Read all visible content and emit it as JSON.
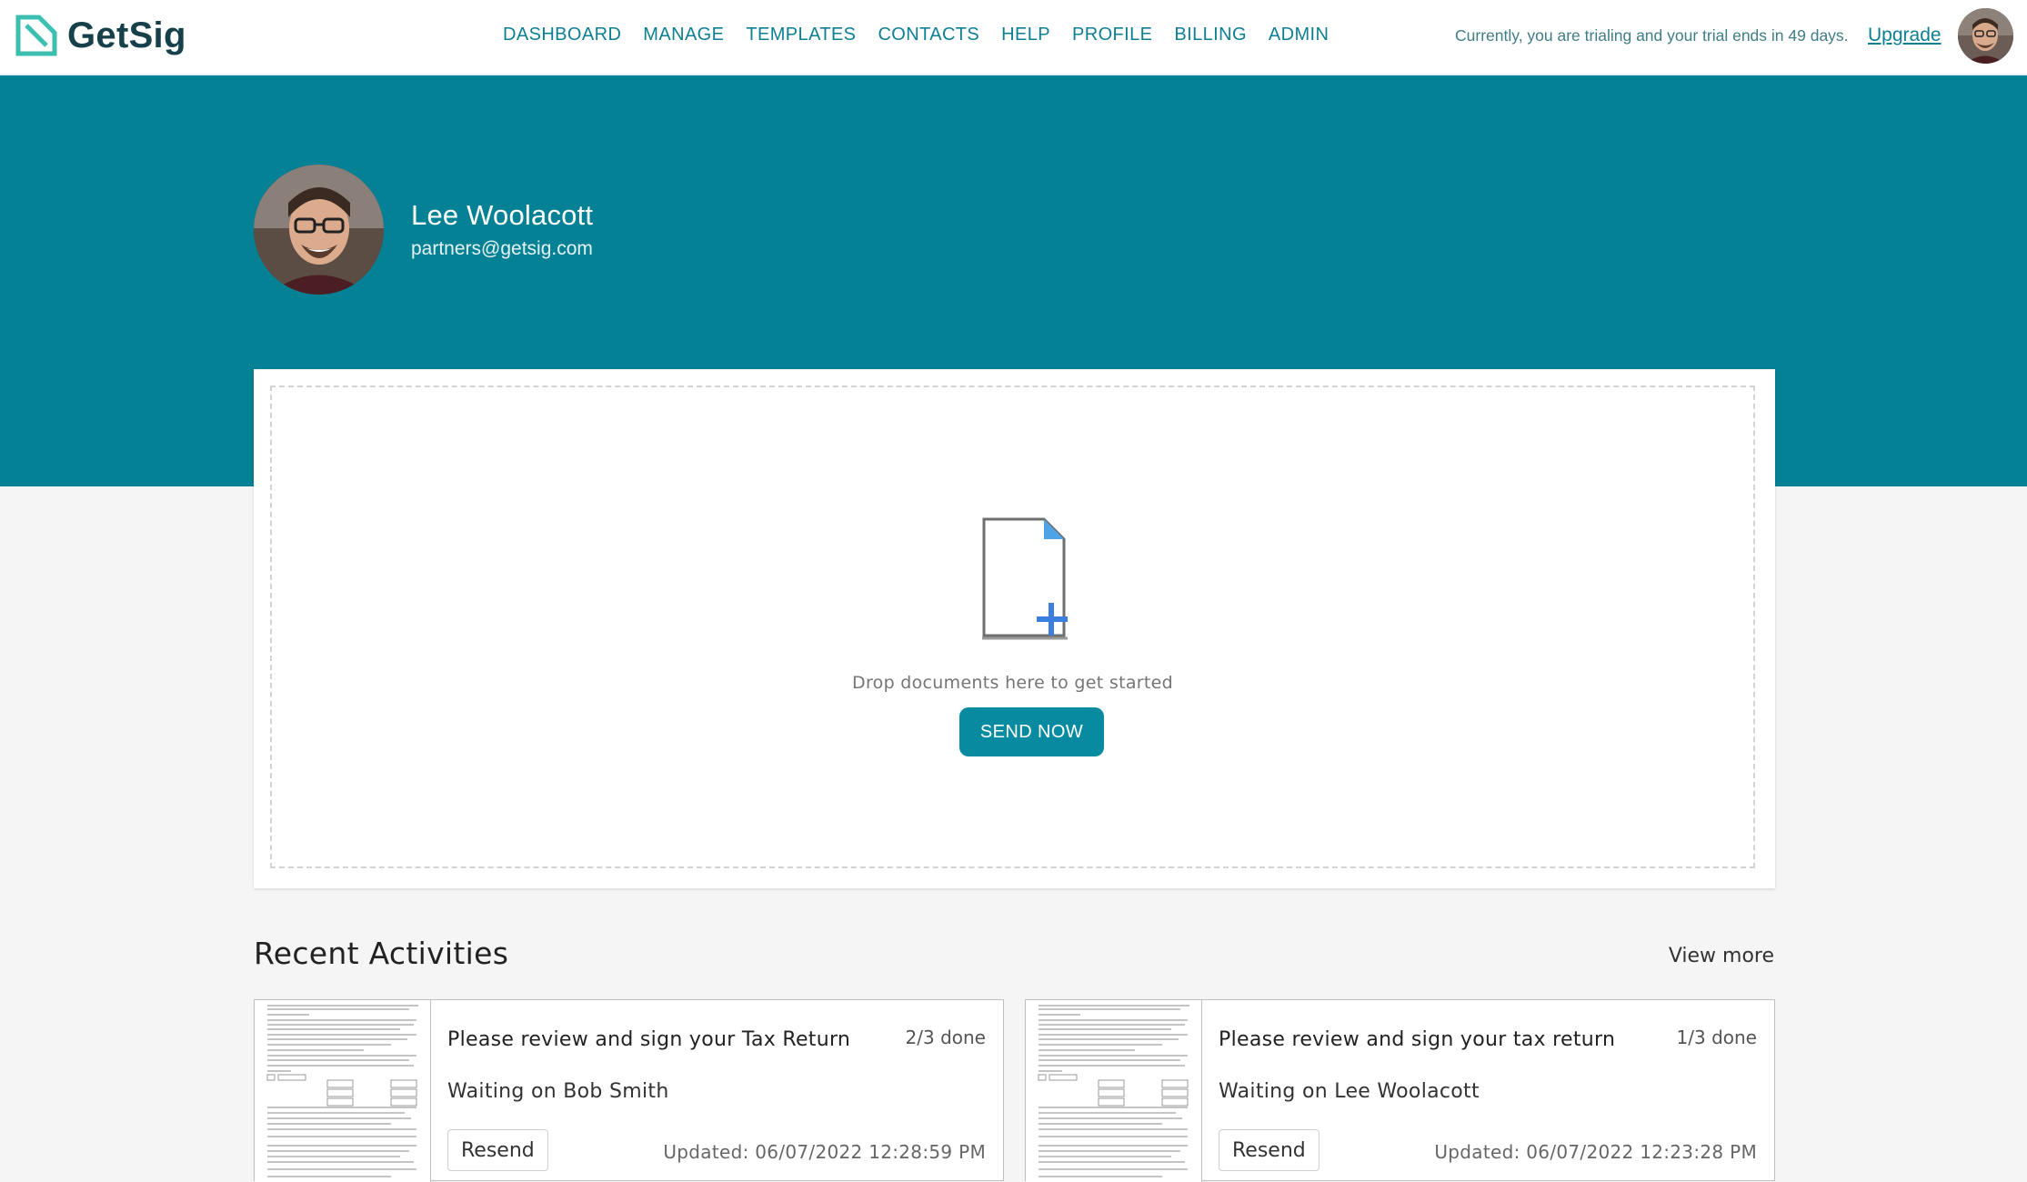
{
  "brand": {
    "name": "GetSig",
    "accent": "#058195",
    "logo_color": "#3bbfb1"
  },
  "nav": {
    "items": [
      "DASHBOARD",
      "MANAGE",
      "TEMPLATES",
      "CONTACTS",
      "HELP",
      "PROFILE",
      "BILLING",
      "ADMIN"
    ]
  },
  "trial": {
    "message": "Currently, you are trialing and your trial ends in 49 days.",
    "upgrade_label": "Upgrade"
  },
  "user": {
    "name": "Lee Woolacott",
    "email": "partners@getsig.com",
    "avatar_icon": "user-avatar"
  },
  "dropzone": {
    "icon": "document-add-icon",
    "text": "Drop documents here to get started",
    "button_label": "SEND NOW"
  },
  "recent": {
    "title": "Recent Activities",
    "view_more_label": "View more",
    "resend_label": "Resend",
    "items": [
      {
        "title": "Please review and sign your Tax Return",
        "progress": "2/3 done",
        "waiting": "Waiting on Bob Smith",
        "updated": "Updated: 06/07/2022 12:28:59 PM"
      },
      {
        "title": "Please review and sign your tax return",
        "progress": "1/3 done",
        "waiting": "Waiting on Lee Woolacott",
        "updated": "Updated: 06/07/2022 12:23:28 PM"
      }
    ]
  }
}
